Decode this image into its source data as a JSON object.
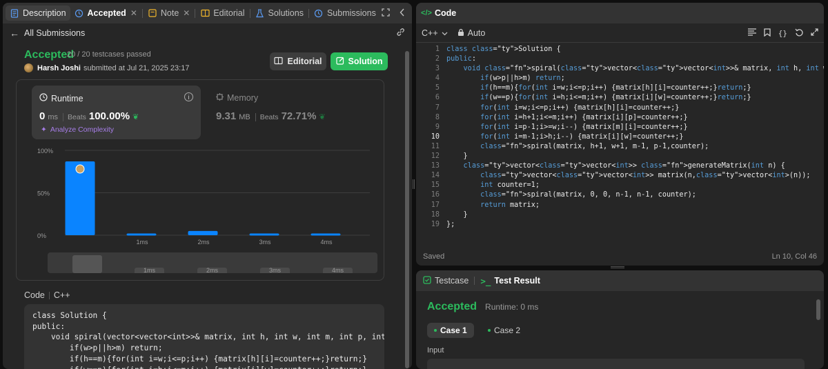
{
  "left_tabs": [
    {
      "label": "Description",
      "icon": "document-icon"
    },
    {
      "label": "Accepted",
      "icon": "history-icon"
    },
    {
      "label": "Note",
      "icon": "note-icon"
    },
    {
      "label": "Editorial",
      "icon": "book-icon"
    },
    {
      "label": "Solutions",
      "icon": "flask-icon"
    },
    {
      "label": "Submissions",
      "icon": "history-icon"
    }
  ],
  "back_link": "All Submissions",
  "submission": {
    "status": "Accepted",
    "testcases": "20 / 20 testcases passed",
    "author": "Harsh Joshi",
    "submitted": "submitted at Jul 21, 2025 23:17",
    "editorial_button": "Editorial",
    "solution_button": "Solution"
  },
  "runtime": {
    "title": "Runtime",
    "value": "0",
    "unit": "ms",
    "beats_label": "Beats",
    "percent": "100.00%",
    "analyze": "Analyze Complexity"
  },
  "memory": {
    "title": "Memory",
    "value": "9.31",
    "unit": "MB",
    "beats_label": "Beats",
    "percent": "72.71%"
  },
  "chart_data": {
    "type": "bar",
    "categories": [
      "",
      "1ms",
      "2ms",
      "3ms",
      "4ms"
    ],
    "values": [
      87,
      2,
      5,
      2,
      2
    ],
    "y_ticks": [
      "100%",
      "50%",
      "0%"
    ],
    "ylim": [
      0,
      100
    ],
    "range_ticks": [
      "1ms",
      "2ms",
      "3ms",
      "4ms"
    ],
    "bar_color": "#0a84ff"
  },
  "code_section": {
    "label": "Code",
    "lang": "C++"
  },
  "submitted_code": "class Solution {\npublic:\n    void spiral(vector<vector<int>>& matrix, int h, int w, int m, int p, int& cou\n        if(w>p||h>m) return;\n        if(h==m){for(int i=w;i<=p;i++) {matrix[h][i]=counter++;}return;}\n        if(w==p){for(int i=h;i<=m;i++) {matrix[i][w]=counter++;}return;}",
  "editor": {
    "title": "Code",
    "language": "C++",
    "mode": "Auto",
    "saved": "Saved",
    "position": "Ln 10, Col 46",
    "current_line": 10,
    "lines": [
      "class Solution {",
      "public:",
      "    void spiral(vector<vector<int>>& matrix, int h, int w, int m, int p, int& counter ){",
      "        if(w>p||h>m) return;",
      "        if(h==m){for(int i=w;i<=p;i++) {matrix[h][i]=counter++;}return;}",
      "        if(w==p){for(int i=h;i<=m;i++) {matrix[i][w]=counter++;}return;}",
      "        for(int i=w;i<=p;i++) {matrix[h][i]=counter++;}",
      "        for(int i=h+1;i<=m;i++) {matrix[i][p]=counter++;}",
      "        for(int i=p-1;i>=w;i--) {matrix[m][i]=counter++;}",
      "        for(int i=m-1;i>h;i--) {matrix[i][w]=counter++;}",
      "        spiral(matrix, h+1, w+1, m-1, p-1,counter);",
      "    }",
      "    vector<vector<int>> generateMatrix(int n) {",
      "        vector<vector<int>> matrix(n,vector<int>(n));",
      "        int counter=1;",
      "        spiral(matrix, 0, 0, n-1, n-1, counter);",
      "        return matrix;",
      "    }",
      "};"
    ]
  },
  "result_panel": {
    "tab_testcase": "Testcase",
    "tab_result": "Test Result",
    "status": "Accepted",
    "runtime": "Runtime: 0 ms",
    "cases": [
      "Case 1",
      "Case 2"
    ],
    "input_label": "Input"
  },
  "colors": {
    "accepted": "#2cbb5d",
    "bar": "#0a84ff",
    "analyze": "#a77ee8"
  }
}
